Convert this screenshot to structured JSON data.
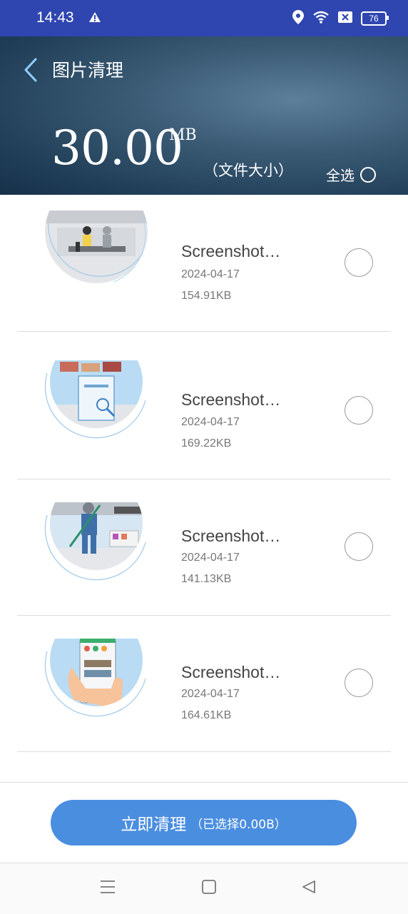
{
  "status": {
    "time": "14:43",
    "battery": "76"
  },
  "header": {
    "back_icon": "chevron-left-icon",
    "title": "图片清理",
    "size_value": "30.00",
    "size_unit": "MB",
    "size_caption": "（文件大小）",
    "select_all": "全选"
  },
  "items": [
    {
      "name": "Screenshot…",
      "date": "2024-04-17",
      "size": "154.91KB"
    },
    {
      "name": "Screenshot…",
      "date": "2024-04-17",
      "size": "169.22KB"
    },
    {
      "name": "Screenshot…",
      "date": "2024-04-17",
      "size": "141.13KB"
    },
    {
      "name": "Screenshot…",
      "date": "2024-04-17",
      "size": "164.61KB"
    }
  ],
  "action": {
    "label": "立即清理",
    "selected_info": "（已选择0.00B）"
  },
  "colors": {
    "status_bar": "#2f46b0",
    "button": "#4a8ee0"
  }
}
